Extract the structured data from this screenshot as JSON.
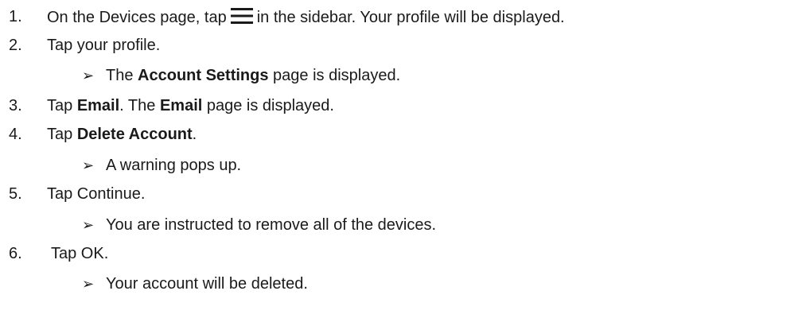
{
  "steps": [
    {
      "number": "1.",
      "before_icon": "On the Devices page, tap",
      "icon": "menu-icon",
      "after_icon": "in the sidebar. Your profile will be displayed."
    },
    {
      "number": "2.",
      "text": "Tap your profile.",
      "result_prefix": "The",
      "result_bold": "Account Settings",
      "result_suffix": "page is displayed."
    },
    {
      "number": "3.",
      "prefix": "Tap",
      "bold1": "Email",
      "mid": ". The",
      "bold2": "Email",
      "suffix": "page is displayed."
    },
    {
      "number": "4.",
      "prefix": "Tap",
      "bold": "Delete Account",
      "suffix": ".",
      "result": "A warning pops up."
    },
    {
      "number": "5.",
      "text": "Tap Continue.",
      "result": "You are instructed to remove all of the devices."
    },
    {
      "number": "6.",
      "text": "Tap OK.",
      "result": "Your account will be deleted."
    }
  ],
  "bullet_glyph": "➢"
}
